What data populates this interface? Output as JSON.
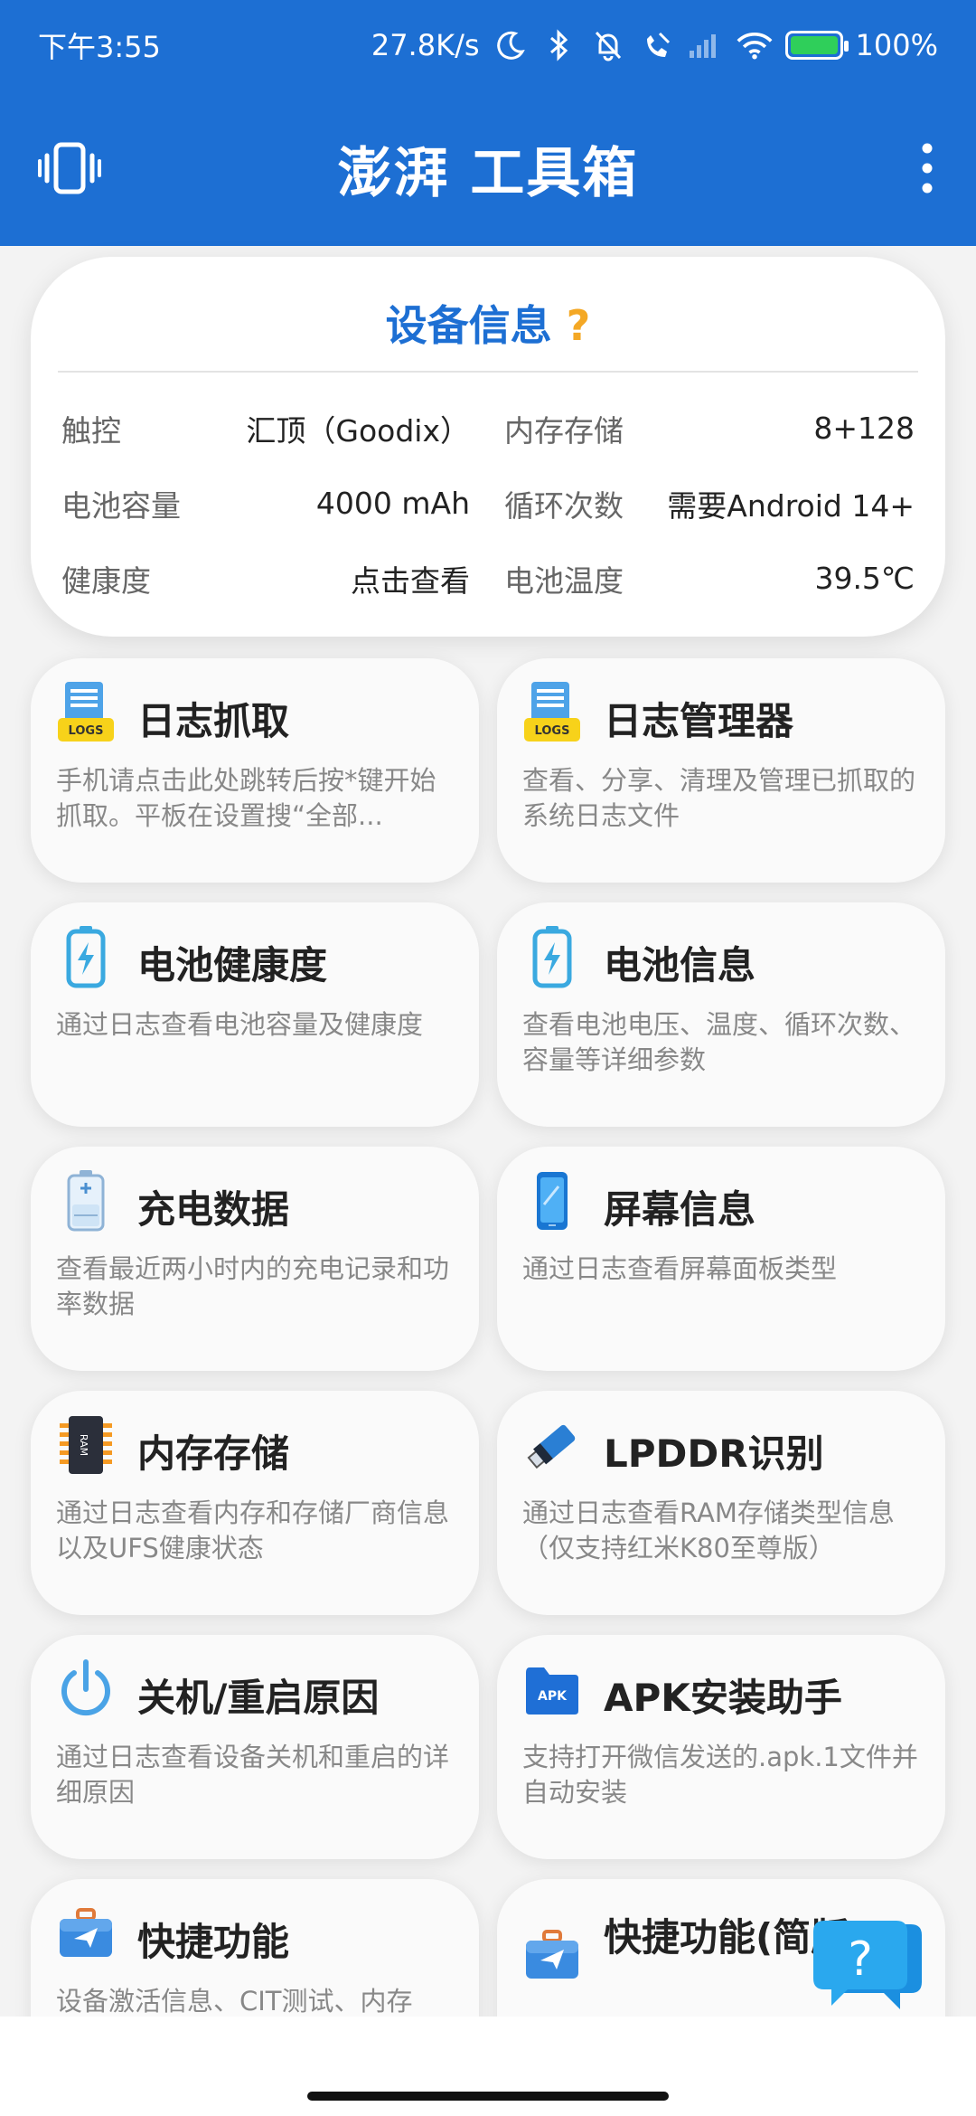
{
  "status_bar": {
    "time": "下午3:55",
    "net_speed": "27.8K/s",
    "battery": "100%"
  },
  "app_bar": {
    "title": "澎湃 工具箱"
  },
  "device_info": {
    "title": "设备信息",
    "title_icon": "?",
    "rows": [
      {
        "left_key": "触控",
        "left_val": "汇顶（Goodix）",
        "right_key": "内存存储",
        "right_val": "8+128"
      },
      {
        "left_key": "电池容量",
        "left_val": "4000 mAh",
        "right_key": "循环次数",
        "right_val": "需要Android 14+"
      },
      {
        "left_key": "健康度",
        "left_val": "点击查看",
        "right_key": "电池温度",
        "right_val": "39.5℃"
      }
    ]
  },
  "cards": [
    {
      "icon": "logs-icon",
      "title": "日志抓取",
      "desc": "手机请点击此处跳转后按*键开始抓取。平板在设置搜“全部..."
    },
    {
      "icon": "logs-icon",
      "title": "日志管理器",
      "desc": "查看、分享、清理及管理已抓取的系统日志文件"
    },
    {
      "icon": "battery-icon",
      "title": "电池健康度",
      "desc": "通过日志查看电池容量及健康度"
    },
    {
      "icon": "battery-icon",
      "title": "电池信息",
      "desc": "查看电池电压、温度、循环次数、容量等详细参数"
    },
    {
      "icon": "charging-icon",
      "title": "充电数据",
      "desc": "查看最近两小时内的充电记录和功率数据"
    },
    {
      "icon": "phone-icon",
      "title": "屏幕信息",
      "desc": "通过日志查看屏幕面板类型"
    },
    {
      "icon": "ram-chip-icon",
      "title": "内存存储",
      "desc": "通过日志查看内存和存储厂商信息以及UFS健康状态"
    },
    {
      "icon": "usb-stick-icon",
      "title": "LPDDR识别",
      "desc": "通过日志查看RAM存储类型信息（仅支持红米K80至尊版）"
    },
    {
      "icon": "power-icon",
      "title": "关机/重启原因",
      "desc": "通过日志查看设备关机和重启的详细原因"
    },
    {
      "icon": "apk-folder-icon",
      "title": "APK安装助手",
      "desc": "支持打开微信发送的.apk.1文件并自动安装"
    },
    {
      "icon": "briefcase-icon",
      "title": "快捷功能",
      "desc": "设备激活信息、CIT测试、内存"
    },
    {
      "icon": "briefcase-icon",
      "title": "快捷功能(简版)",
      "desc": ""
    }
  ],
  "logs_badge": "LOGS",
  "ram_badge": "RAM",
  "apk_badge": "APK",
  "fab_label": "?",
  "colors": {
    "primary": "#1d6fd3",
    "accent": "#f4a825"
  }
}
